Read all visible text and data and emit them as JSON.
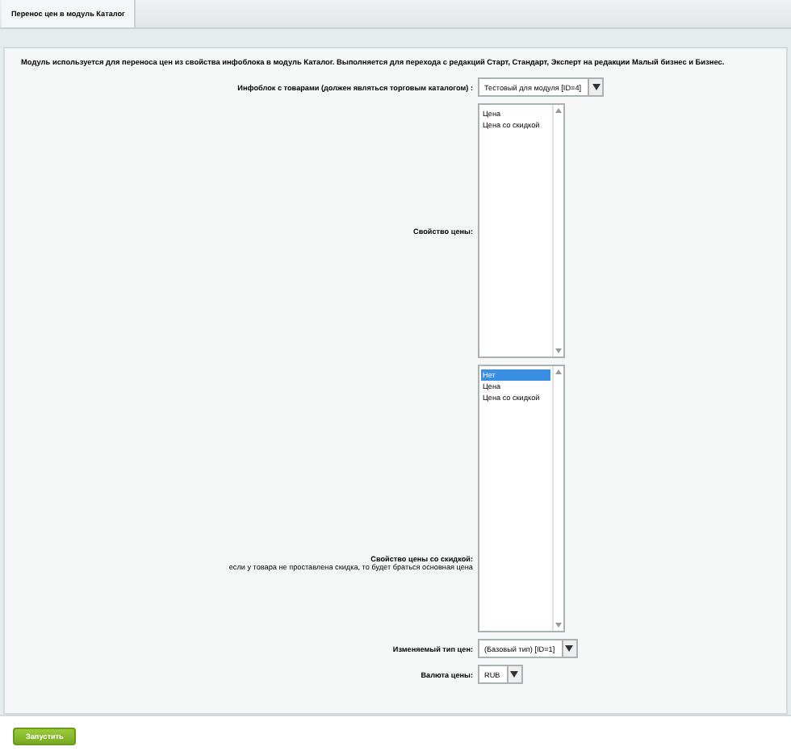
{
  "tabs": [
    {
      "label": "Перенос цен в модуль Каталог",
      "selected": true
    }
  ],
  "description": "Модуль используется для переноса цен из свойства инфоблока в модуль Каталог. Выполняется для перехода с редакций Старт, Стандарт, Эксперт на редакции Малый бизнес и Бизнес.",
  "fields": [
    {
      "kind": "select",
      "label": [
        "Инфоблок с товарами (должен являться торговым каталогом) :"
      ],
      "value": "Тестовый для модуля [ID=4]"
    },
    {
      "kind": "list",
      "label": [
        "Свойство цены:"
      ],
      "options": [
        {
          "label": "Цена",
          "selected": false
        },
        {
          "label": "Цена со скидкой",
          "selected": false
        }
      ]
    },
    {
      "kind": "list",
      "label": [
        "Свойство цены со скидкой:",
        "если у товара не проставлена скидка, то будет браться основная цена"
      ],
      "options": [
        {
          "label": "Нет",
          "selected": true
        },
        {
          "label": "Цена",
          "selected": false
        },
        {
          "label": "Цена со скидкой",
          "selected": false
        }
      ]
    },
    {
      "kind": "select",
      "label": [
        "Изменяемый тип цен:"
      ],
      "value": "(Базовый тип) [ID=1]"
    },
    {
      "kind": "select",
      "label": [
        "Валюта цены:"
      ],
      "value": "RUB"
    }
  ],
  "run_button": "Запустить"
}
